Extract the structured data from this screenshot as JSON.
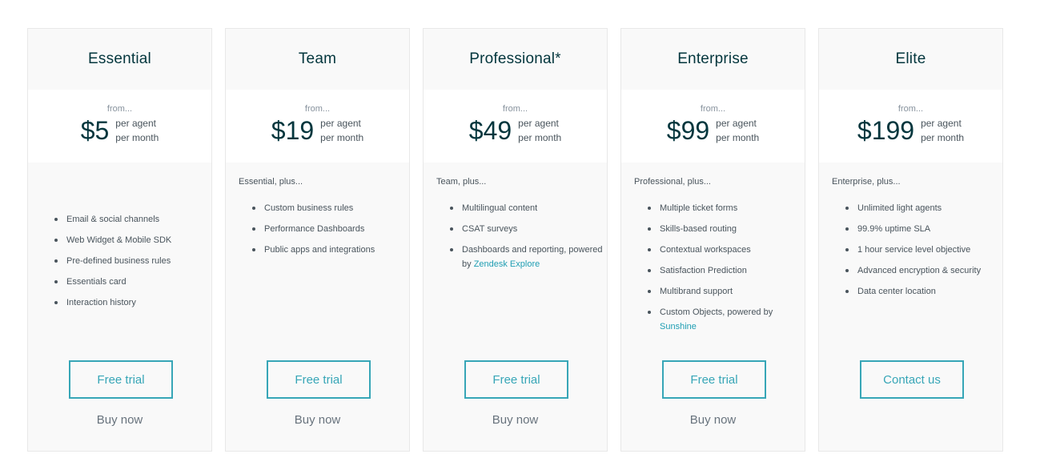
{
  "plans": [
    {
      "name": "Essential",
      "from": "from...",
      "price": "$5",
      "per_line1": "per agent",
      "per_line2": "per month",
      "plus": "",
      "features": [
        {
          "text": "Email & social channels"
        },
        {
          "text": "Web Widget & Mobile SDK"
        },
        {
          "text": "Pre-defined business rules"
        },
        {
          "text": "Essentials card"
        },
        {
          "text": "Interaction history"
        }
      ],
      "primary_button": "Free trial",
      "secondary_link": "Buy now"
    },
    {
      "name": "Team",
      "from": "from...",
      "price": "$19",
      "per_line1": "per agent",
      "per_line2": "per month",
      "plus": "Essential, plus...",
      "features": [
        {
          "text": "Custom business rules"
        },
        {
          "text": "Performance Dashboards"
        },
        {
          "text": "Public apps and integrations"
        }
      ],
      "primary_button": "Free trial",
      "secondary_link": "Buy now"
    },
    {
      "name": "Professional*",
      "from": "from...",
      "price": "$49",
      "per_line1": "per agent",
      "per_line2": "per month",
      "plus": "Team, plus...",
      "features": [
        {
          "text": "Multilingual content"
        },
        {
          "text": "CSAT surveys"
        },
        {
          "text": "Dashboards and reporting, powered by ",
          "link": "Zendesk Explore"
        }
      ],
      "primary_button": "Free trial",
      "secondary_link": "Buy now"
    },
    {
      "name": "Enterprise",
      "from": "from...",
      "price": "$99",
      "per_line1": "per agent",
      "per_line2": "per month",
      "plus": "Professional, plus...",
      "features": [
        {
          "text": "Multiple ticket forms"
        },
        {
          "text": "Skills-based routing"
        },
        {
          "text": "Contextual workspaces"
        },
        {
          "text": "Satisfaction Prediction"
        },
        {
          "text": "Multibrand support"
        },
        {
          "text": "Custom Objects, powered by ",
          "link": "Sunshine"
        }
      ],
      "primary_button": "Free trial",
      "secondary_link": "Buy now"
    },
    {
      "name": "Elite",
      "from": "from...",
      "price": "$199",
      "per_line1": "per agent",
      "per_line2": "per month",
      "plus": "Enterprise, plus...",
      "features": [
        {
          "text": "Unlimited light agents"
        },
        {
          "text": "99.9% uptime SLA"
        },
        {
          "text": "1 hour service level objective"
        },
        {
          "text": "Advanced encryption & security"
        },
        {
          "text": "Data center location"
        }
      ],
      "primary_button": "Contact us",
      "secondary_link": ""
    }
  ],
  "colors": {
    "heading": "#03363d",
    "body_text": "#49545c",
    "accent": "#37a6b7",
    "link": "#1f9eb3",
    "muted": "#68737d"
  }
}
